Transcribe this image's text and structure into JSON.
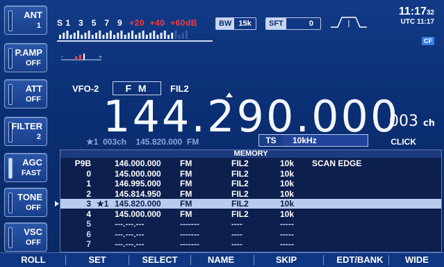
{
  "left_keys": [
    {
      "name": "ANT",
      "value": "1",
      "active": false
    },
    {
      "name": "P.AMP",
      "value": "OFF",
      "active": false
    },
    {
      "name": "ATT",
      "value": "OFF",
      "active": false
    },
    {
      "name": "FILTER",
      "value": "2",
      "active": false
    },
    {
      "name": "AGC",
      "value": "FAST",
      "active": true
    },
    {
      "name": "TONE",
      "value": "OFF",
      "active": false
    },
    {
      "name": "VSC",
      "value": "OFF",
      "active": false
    }
  ],
  "smeter": {
    "labels_white": "S 1   3   5   7   9",
    "labels_red": "+20  +40  +60dB"
  },
  "badges": {
    "bw_label": "BW",
    "bw_value": "15k",
    "sft_label": "SFT",
    "sft_value": "0"
  },
  "clock": {
    "time": "11:17",
    "seconds": "32",
    "utc": "UTC 11:17",
    "cf": "CF"
  },
  "vfo": {
    "label": "VFO-2",
    "mode": "F M",
    "filter": "FIL2"
  },
  "frequency": "144.290.000",
  "channel": {
    "number": "003",
    "unit": "ch"
  },
  "subline": "★1  003ch    145.820.000  FM",
  "ts": {
    "label": "TS",
    "value": "10kHz"
  },
  "click": "CLICK",
  "memory": {
    "title": "MEMORY",
    "rows": [
      {
        "ch": "P9B",
        "star": "",
        "freq": "146.000.000",
        "mode": "FM",
        "fil": "FIL2",
        "ts": "10k",
        "name": "SCAN EDGE",
        "selected": false
      },
      {
        "ch": "0",
        "star": "",
        "freq": "145.000.000",
        "mode": "FM",
        "fil": "FIL2",
        "ts": "10k",
        "name": "",
        "selected": false
      },
      {
        "ch": "1",
        "star": "",
        "freq": "146.995.000",
        "mode": "FM",
        "fil": "FIL2",
        "ts": "10k",
        "name": "",
        "selected": false
      },
      {
        "ch": "2",
        "star": "",
        "freq": "145.814.950",
        "mode": "FM",
        "fil": "FIL2",
        "ts": "10k",
        "name": "",
        "selected": false
      },
      {
        "ch": "3",
        "star": "★1",
        "freq": "145.820.000",
        "mode": "FM",
        "fil": "FIL2",
        "ts": "10k",
        "name": "",
        "selected": true
      },
      {
        "ch": "4",
        "star": "",
        "freq": "145.000.000",
        "mode": "FM",
        "fil": "FIL2",
        "ts": "10k",
        "name": "",
        "selected": false
      },
      {
        "ch": "5",
        "star": "",
        "freq": "---.---.---",
        "mode": "-------",
        "fil": "----",
        "ts": "-----",
        "name": "",
        "selected": false
      },
      {
        "ch": "6",
        "star": "",
        "freq": "---.---.---",
        "mode": "-------",
        "fil": "----",
        "ts": "-----",
        "name": "",
        "selected": false
      },
      {
        "ch": "7",
        "star": "",
        "freq": "---.---.---",
        "mode": "-------",
        "fil": "----",
        "ts": "-----",
        "name": "",
        "selected": false
      }
    ]
  },
  "bottom_keys": [
    "ROLL",
    "SET",
    "SELECT",
    "NAME",
    "SKIP",
    "EDT/BANK",
    "WIDE"
  ],
  "colors": {
    "background": "#0b2d6e",
    "highlight": "#b9ccf0",
    "red_scale": "#ff3b3b"
  }
}
